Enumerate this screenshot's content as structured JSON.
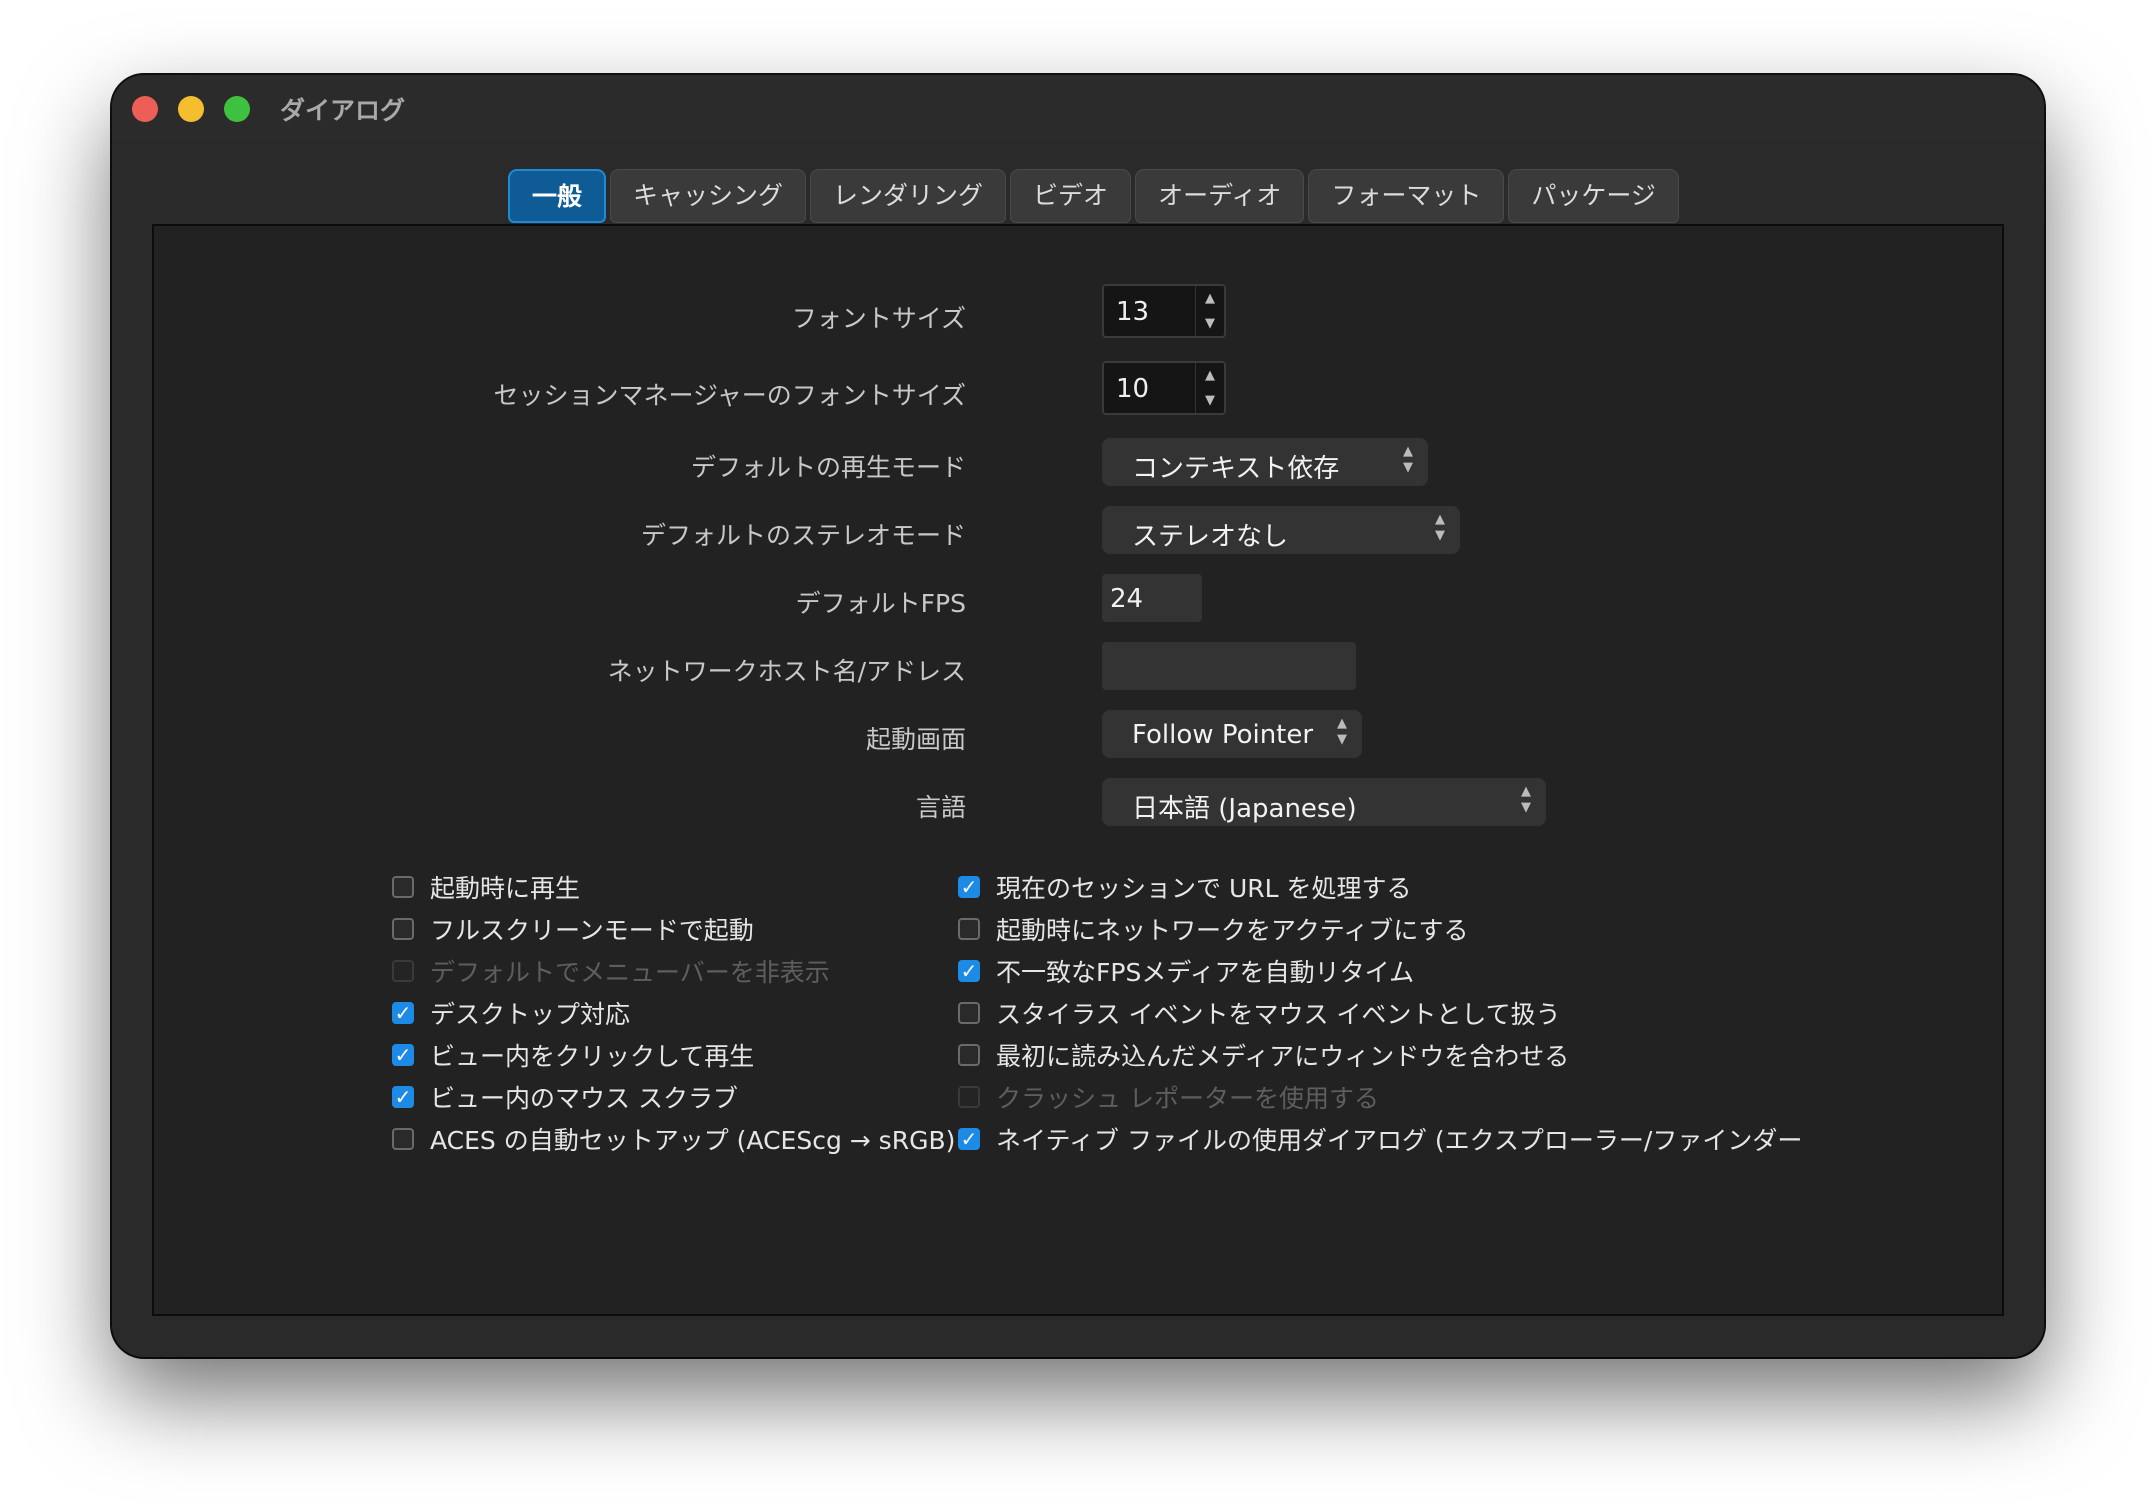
{
  "window": {
    "title": "ダイアログ"
  },
  "tabs": [
    {
      "label": "一般",
      "active": true
    },
    {
      "label": "キャッシング",
      "active": false
    },
    {
      "label": "レンダリング",
      "active": false
    },
    {
      "label": "ビデオ",
      "active": false
    },
    {
      "label": "オーディオ",
      "active": false
    },
    {
      "label": "フォーマット",
      "active": false
    },
    {
      "label": "パッケージ",
      "active": false
    }
  ],
  "form": {
    "font_size": {
      "label": "フォントサイズ",
      "value": "13"
    },
    "session_font_size": {
      "label": "セッションマネージャーのフォントサイズ",
      "value": "10"
    },
    "play_mode": {
      "label": "デフォルトの再生モード",
      "value": "コンテキスト依存"
    },
    "stereo_mode": {
      "label": "デフォルトのステレオモード",
      "value": "ステレオなし"
    },
    "fps": {
      "label": "デフォルトFPS",
      "value": "24"
    },
    "network_host": {
      "label": "ネットワークホスト名/アドレス",
      "value": ""
    },
    "startup_screen": {
      "label": "起動画面",
      "value": "Follow Pointer"
    },
    "language": {
      "label": "言語",
      "value": "日本語 (Japanese)"
    }
  },
  "checks_left": [
    {
      "label": "起動時に再生",
      "checked": false,
      "disabled": false
    },
    {
      "label": "フルスクリーンモードで起動",
      "checked": false,
      "disabled": false
    },
    {
      "label": "デフォルトでメニューバーを非表示",
      "checked": false,
      "disabled": true
    },
    {
      "label": "デスクトップ対応",
      "checked": true,
      "disabled": false
    },
    {
      "label": "ビュー内をクリックして再生",
      "checked": true,
      "disabled": false
    },
    {
      "label": "ビュー内のマウス スクラブ",
      "checked": true,
      "disabled": false
    },
    {
      "label": "ACES の自動セットアップ (ACEScg → sRGB)",
      "checked": false,
      "disabled": false
    }
  ],
  "checks_right": [
    {
      "label": "現在のセッションで URL を処理する",
      "checked": true,
      "disabled": false
    },
    {
      "label": "起動時にネットワークをアクティブにする",
      "checked": false,
      "disabled": false
    },
    {
      "label": "不一致なFPSメディアを自動リタイム",
      "checked": true,
      "disabled": false
    },
    {
      "label": "スタイラス イベントをマウス イベントとして扱う",
      "checked": false,
      "disabled": false
    },
    {
      "label": "最初に読み込んだメディアにウィンドウを合わせる",
      "checked": false,
      "disabled": false
    },
    {
      "label": "クラッシュ レポーターを使用する",
      "checked": false,
      "disabled": true
    },
    {
      "label": "ネイティブ ファイルの使用ダイアログ (エクスプローラー/ファインダー",
      "checked": true,
      "disabled": false
    }
  ],
  "icons": {
    "check_mark": "✓",
    "spin_up": "▲",
    "spin_down": "▼",
    "combo_arrows": "▲▼"
  },
  "colors": {
    "accent": "#1d8ae6",
    "active_tab": "#0f5b95",
    "close": "#ec5f57",
    "minimize": "#f4be2e",
    "maximize": "#3ec13f"
  }
}
